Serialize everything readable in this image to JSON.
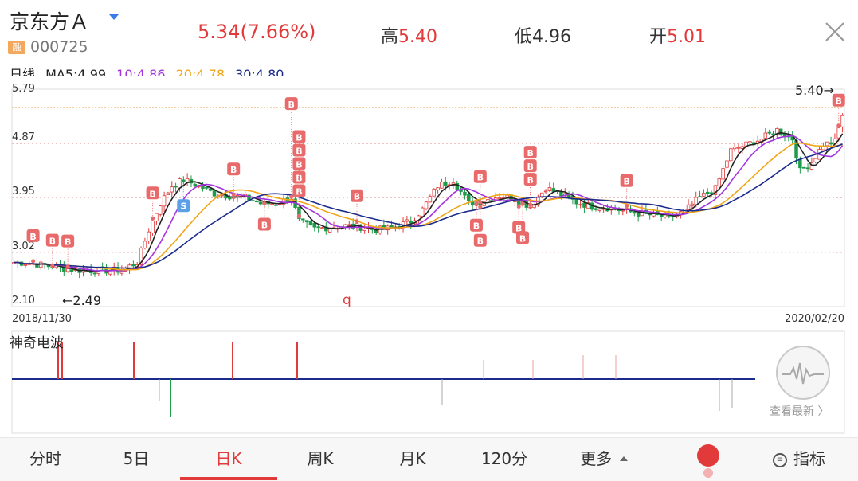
{
  "header": {
    "stock_name": "京东方Ａ",
    "badge": "融",
    "stock_code": "000725",
    "price_change": "5.34(7.66%)",
    "high_label": "高",
    "high_value": "5.40",
    "low_label": "低",
    "low_value": "4.96",
    "open_label": "开",
    "open_value": "5.01"
  },
  "ma_row": {
    "period_label": "日线",
    "ma5": "MA5:4.99",
    "ma10": "10:4.86",
    "ma20": "20:4.78",
    "ma30": "30:4.80"
  },
  "kline": {
    "y_labels": [
      "5.79",
      "4.87",
      "3.95",
      "3.02",
      "2.10"
    ],
    "max_price_label": "5.40→",
    "min_price_label": "←2.49",
    "marker_q": "q",
    "date_start": "2018/11/30",
    "date_end": "2020/02/20",
    "buy_label": "B",
    "sell_label": "S"
  },
  "oscillator": {
    "title": "神奇电波",
    "latest_label": "查看最新 〉"
  },
  "tabs": {
    "t1": "分时",
    "t2": "5日",
    "t3": "日K",
    "t4": "周K",
    "t5": "月K",
    "t6": "120分",
    "t7": "更多",
    "indicator": "指标"
  },
  "colors": {
    "up": "#e23a3a",
    "down": "#1e9b4a",
    "ma5": "#222222",
    "ma10": "#a335e0",
    "ma20": "#f0a616",
    "ma30": "#1c2c8c",
    "accent": "#e23a3a",
    "marker": "#e86a6a"
  },
  "chart_data": {
    "type": "candlestick",
    "x_range": [
      "2018/11/30",
      "2020/02/20"
    ],
    "ylim": [
      2.1,
      5.79
    ],
    "y_ticks": [
      5.79,
      4.87,
      3.95,
      3.02,
      2.1
    ],
    "close_path": [
      [
        0,
        2.85
      ],
      [
        4,
        2.84
      ],
      [
        8,
        2.8
      ],
      [
        12,
        2.76
      ],
      [
        16,
        2.72
      ],
      [
        22,
        2.71
      ],
      [
        28,
        2.72
      ],
      [
        32,
        2.85
      ],
      [
        35,
        3.4
      ],
      [
        38,
        3.85
      ],
      [
        41,
        4.15
      ],
      [
        44,
        4.25
      ],
      [
        48,
        4.15
      ],
      [
        52,
        4.02
      ],
      [
        56,
        3.98
      ],
      [
        60,
        3.95
      ],
      [
        64,
        3.85
      ],
      [
        68,
        3.85
      ],
      [
        72,
        3.95
      ],
      [
        74,
        3.55
      ],
      [
        78,
        3.42
      ],
      [
        82,
        3.45
      ],
      [
        86,
        3.47
      ],
      [
        90,
        3.45
      ],
      [
        94,
        3.4
      ],
      [
        98,
        3.43
      ],
      [
        103,
        3.55
      ],
      [
        106,
        3.75
      ],
      [
        110,
        4.15
      ],
      [
        114,
        4.25
      ],
      [
        118,
        3.85
      ],
      [
        122,
        3.9
      ],
      [
        126,
        3.98
      ],
      [
        130,
        3.93
      ],
      [
        134,
        3.8
      ],
      [
        138,
        4.12
      ],
      [
        142,
        4.0
      ],
      [
        146,
        3.87
      ],
      [
        150,
        3.8
      ],
      [
        154,
        3.78
      ],
      [
        158,
        3.73
      ],
      [
        162,
        3.68
      ],
      [
        166,
        3.65
      ],
      [
        170,
        3.6
      ],
      [
        174,
        3.72
      ],
      [
        178,
        3.95
      ],
      [
        182,
        4.1
      ],
      [
        186,
        4.75
      ],
      [
        190,
        4.85
      ],
      [
        194,
        4.95
      ],
      [
        198,
        5.1
      ],
      [
        202,
        4.95
      ],
      [
        204,
        4.4
      ],
      [
        207,
        4.55
      ],
      [
        210,
        4.85
      ],
      [
        213,
        4.9
      ],
      [
        215,
        5.34
      ]
    ],
    "series": [
      {
        "name": "MA5",
        "value": 4.99
      },
      {
        "name": "10",
        "value": 4.86
      },
      {
        "name": "20",
        "value": 4.78
      },
      {
        "name": "30",
        "value": 4.8
      }
    ],
    "annotations": {
      "max": 5.4,
      "min": 2.49
    }
  }
}
